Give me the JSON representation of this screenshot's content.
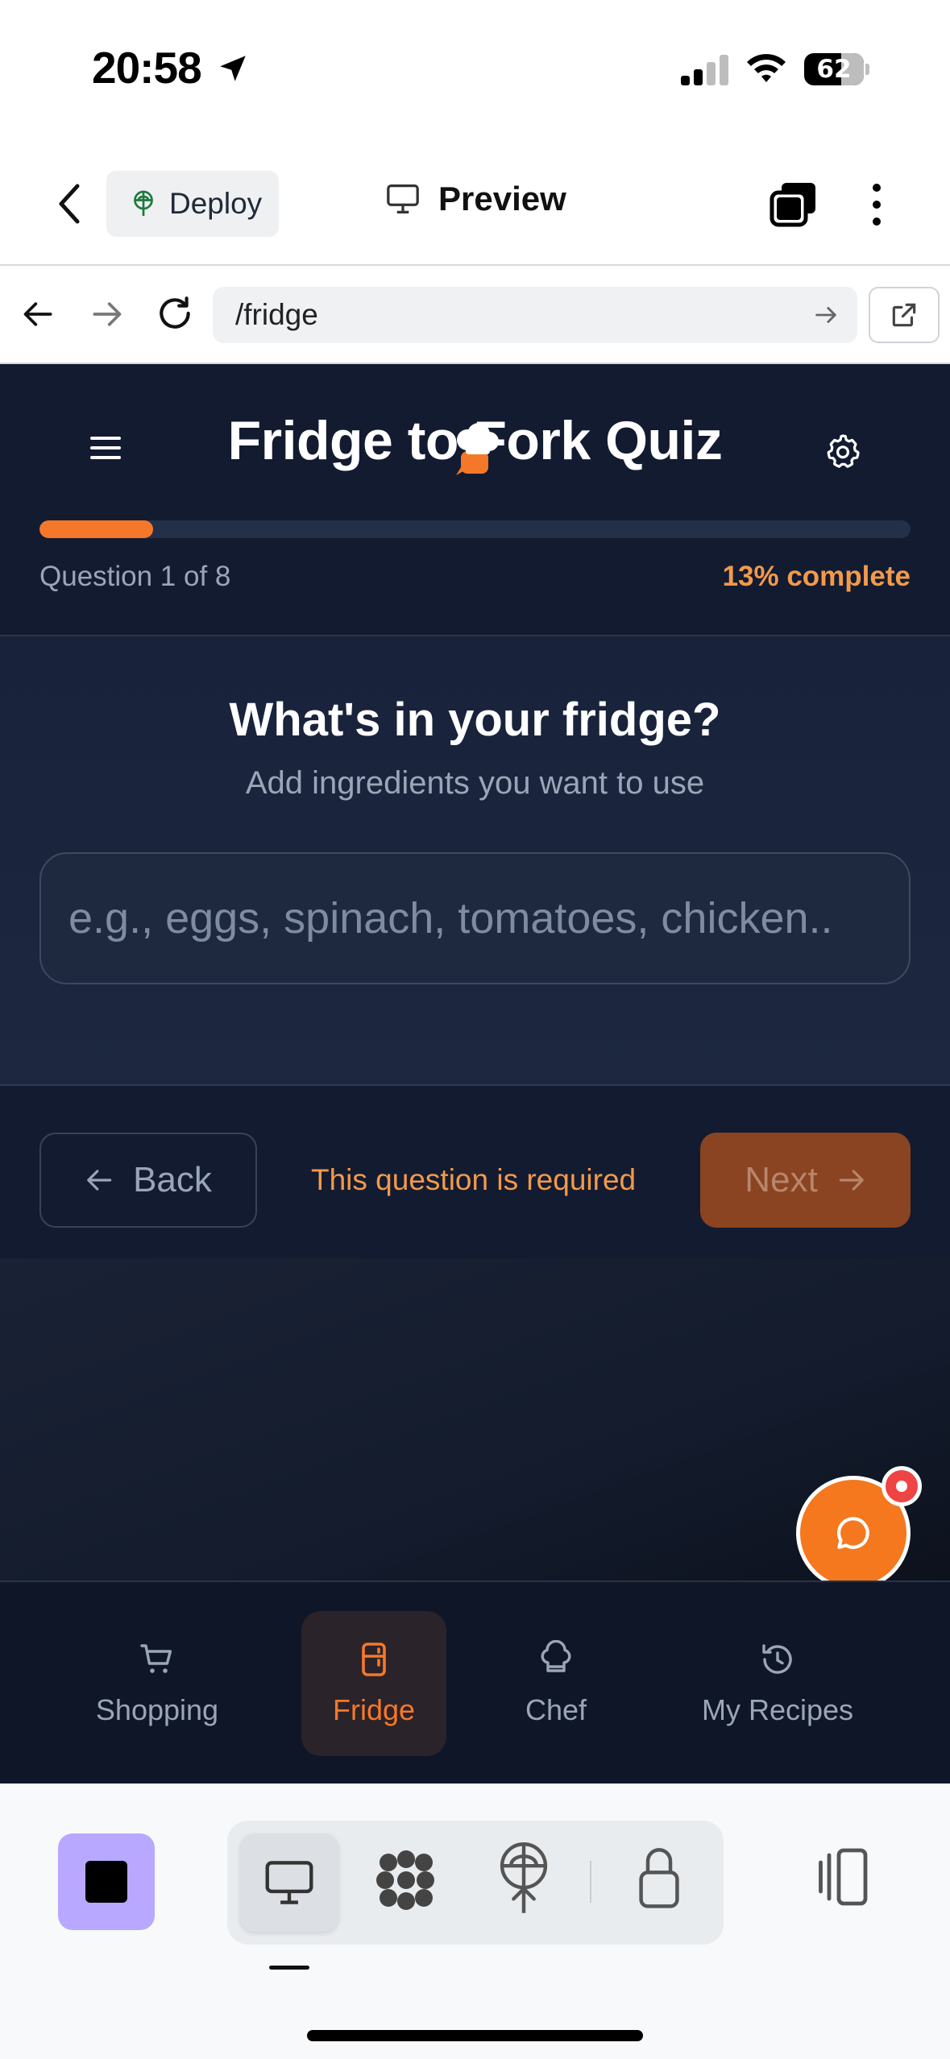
{
  "status_bar": {
    "time": "20:58",
    "battery": "62",
    "battery_level": 0.62
  },
  "top_bar": {
    "deploy_label": "Deploy",
    "preview_label": "Preview"
  },
  "url_bar": {
    "url": "/fridge"
  },
  "quiz": {
    "title": "Fridge to Fork Quiz",
    "question_count": "Question 1 of 8",
    "percent_complete": "13% complete",
    "progress": 0.13
  },
  "question": {
    "title": "What's in your fridge?",
    "subtitle": "Add ingredients you want to use",
    "placeholder": "e.g., eggs, spinach, tomatoes, chicken..",
    "value": ""
  },
  "actions": {
    "back_label": "Back",
    "required_message": "This question is required",
    "next_label": "Next"
  },
  "bottom_nav": {
    "items": [
      {
        "label": "Shopping",
        "icon": "cart-icon"
      },
      {
        "label": "Fridge",
        "icon": "fridge-icon",
        "active": true
      },
      {
        "label": "Chef",
        "icon": "chef-hat-icon"
      },
      {
        "label": "My Recipes",
        "icon": "history-icon"
      }
    ]
  },
  "colors": {
    "accent": "#f5782a",
    "header_bg": "#131b31",
    "next_button_disabled": "#8a4421",
    "stop_button": "#b9a8ff"
  }
}
